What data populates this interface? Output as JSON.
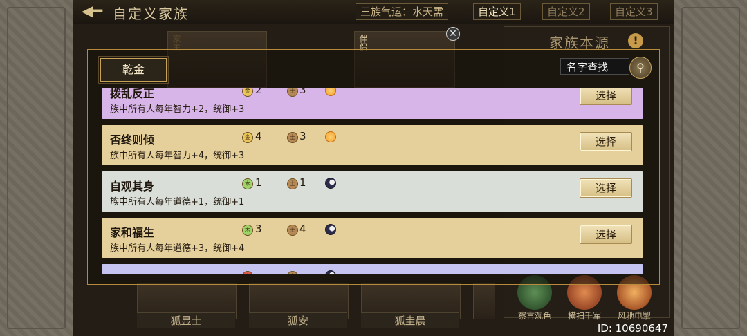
{
  "header": {
    "title": "自定义家族",
    "fortune_tab": "三族气运：水天需",
    "custom_tabs": [
      "自定义1",
      "自定义2",
      "自定义3"
    ]
  },
  "background": {
    "card_tags": [
      "家主",
      "伴侣"
    ],
    "member_names": [
      "狐显士",
      "狐安",
      "狐圭晨"
    ],
    "source_title": "家族本源",
    "skills": [
      "察言观色",
      "横扫千军",
      "风驰电掣"
    ],
    "id_text": "ID: 10690647"
  },
  "dialog": {
    "category_tab": "乾金",
    "search_placeholder": "名字查找",
    "choose_label": "选择",
    "rows": [
      {
        "name": "拨乱反正",
        "desc": "族中所有人每年智力+2，统御+3",
        "res1_icon": "金",
        "res1_value": "2",
        "res2_icon": "土",
        "res2_value": "3",
        "orb": "sun",
        "bg": "#d8b5e8"
      },
      {
        "name": "否终则倾",
        "desc": "族中所有人每年智力+4，统御+3",
        "res1_icon": "金",
        "res1_value": "4",
        "res2_icon": "土",
        "res2_value": "3",
        "orb": "sun",
        "bg": "#e5cf9a"
      },
      {
        "name": "自观其身",
        "desc": "族中所有人每年道德+1，统御+1",
        "res1_icon": "木",
        "res1_value": "1",
        "res2_icon": "土",
        "res2_value": "1",
        "orb": "moon",
        "bg": "#d9dfd8"
      },
      {
        "name": "家和福生",
        "desc": "族中所有人每年道德+3，统御+4",
        "res1_icon": "木",
        "res1_value": "3",
        "res2_icon": "土",
        "res2_value": "4",
        "orb": "moon",
        "bg": "#e5cf9a"
      },
      {
        "name": "",
        "desc": "",
        "res1_icon": "火",
        "res1_value": "",
        "res2_icon": "土",
        "res2_value": "",
        "orb": "moon",
        "bg": "#c5c3ef"
      }
    ]
  },
  "colors": {
    "gold_coin": "#e9c55a",
    "wood_coin": "#9ed36a",
    "earth_coin": "#b68a57",
    "fire_coin": "#e05a4a",
    "sun": "#f0a030",
    "moon": "#2c2c4a"
  }
}
